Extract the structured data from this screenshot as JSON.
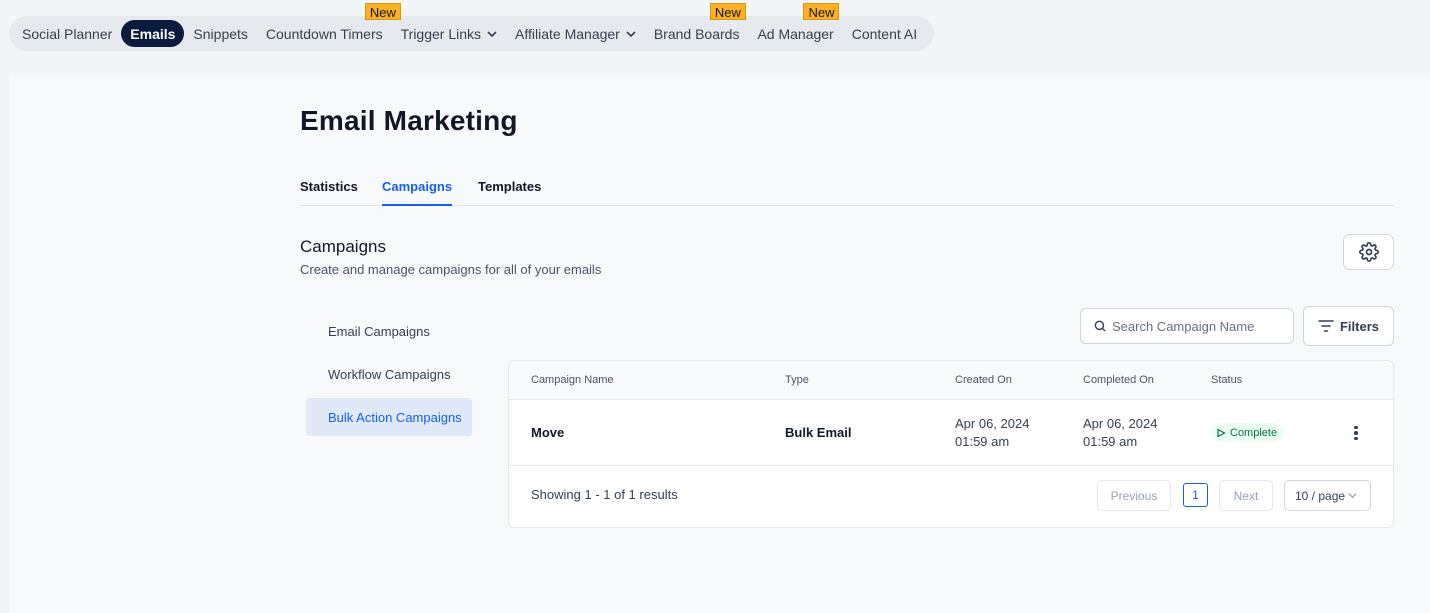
{
  "topnav": {
    "items": [
      {
        "label": "Social Planner",
        "badge": ""
      },
      {
        "label": "Emails",
        "badge": "",
        "active": true
      },
      {
        "label": "Snippets",
        "badge": ""
      },
      {
        "label": "Countdown Timers",
        "badge": "New"
      },
      {
        "label": "Trigger Links",
        "badge": "",
        "dropdown": true
      },
      {
        "label": "Affiliate Manager",
        "badge": "",
        "dropdown": true
      },
      {
        "label": "Brand Boards",
        "badge": "New"
      },
      {
        "label": "Ad Manager",
        "badge": "New"
      },
      {
        "label": "Content AI",
        "badge": ""
      }
    ]
  },
  "page": {
    "title": "Email Marketing"
  },
  "tabs": [
    {
      "label": "Statistics"
    },
    {
      "label": "Campaigns",
      "active": true
    },
    {
      "label": "Templates"
    }
  ],
  "section": {
    "title": "Campaigns",
    "subtitle": "Create and manage campaigns for all of your emails"
  },
  "side_menu": [
    {
      "label": "Email Campaigns"
    },
    {
      "label": "Workflow Campaigns"
    },
    {
      "label": "Bulk Action Campaigns",
      "active": true
    }
  ],
  "search": {
    "placeholder": "Search Campaign Name",
    "value": ""
  },
  "filters_label": "Filters",
  "table": {
    "columns": [
      "Campaign Name",
      "Type",
      "Created On",
      "Completed On",
      "Status"
    ],
    "rows": [
      {
        "name": "Move",
        "type": "Bulk Email",
        "created_date": "Apr 06, 2024",
        "created_time": "01:59 am",
        "completed_date": "Apr 06, 2024",
        "completed_time": "01:59 am",
        "status": "Complete"
      }
    ]
  },
  "pagination": {
    "showing": "Showing 1 - 1 of 1 results",
    "previous": "Previous",
    "page": "1",
    "next": "Next",
    "per_page": "10 / page"
  },
  "colors": {
    "accent": "#155eef",
    "nav_active": "#0b1b3d",
    "badge_new": "#fdb022",
    "status_complete": "#067647"
  }
}
